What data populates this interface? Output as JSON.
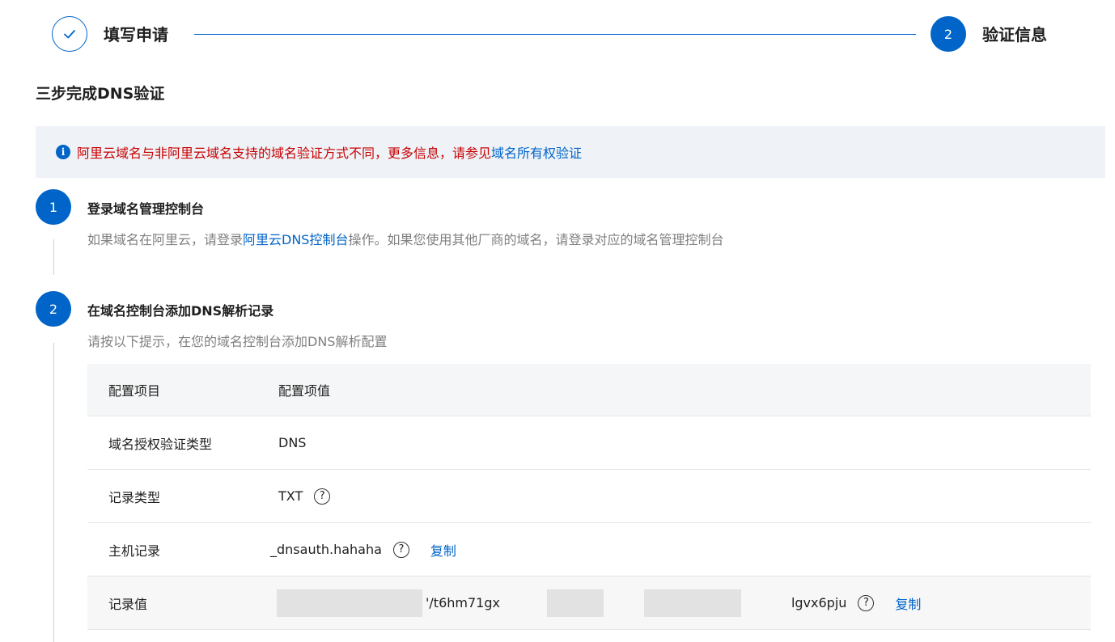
{
  "stepper": {
    "step1_title": "填写申请",
    "step2_number": "2",
    "step2_title": "验证信息"
  },
  "section_title": "三步完成DNS验证",
  "alert": {
    "text": "阿里云域名与非阿里云域名支持的域名验证方式不同，更多信息，请参见",
    "link": "域名所有权验证"
  },
  "steps": [
    {
      "number": "1",
      "title": "登录域名管理控制台",
      "desc_prefix": "如果域名在阿里云，请登录",
      "desc_link": "阿里云DNS控制台",
      "desc_suffix": "操作。如果您使用其他厂商的域名，请登录对应的域名管理控制台"
    },
    {
      "number": "2",
      "title": "在域名控制台添加DNS解析记录",
      "desc": "请按以下提示，在您的域名控制台添加DNS解析配置"
    }
  ],
  "table": {
    "headers": [
      "配置项目",
      "配置项值"
    ],
    "rows": [
      {
        "label": "域名授权验证类型",
        "value": "DNS"
      },
      {
        "label": "记录类型",
        "value": "TXT"
      },
      {
        "label": "主机记录",
        "value": "_dnsauth.hahaha",
        "copy": "复制"
      },
      {
        "label": "记录值",
        "value_part1": "'/t6hm71gx",
        "value_part2": "lgvx6pju",
        "copy": "复制"
      }
    ],
    "help_glyph": "?"
  },
  "icons": {
    "check": "check-icon",
    "info": "info-icon",
    "help": "question-circle-icon"
  },
  "colors": {
    "primary": "#0064c8",
    "warning_text": "#c80000",
    "muted": "#808080"
  }
}
